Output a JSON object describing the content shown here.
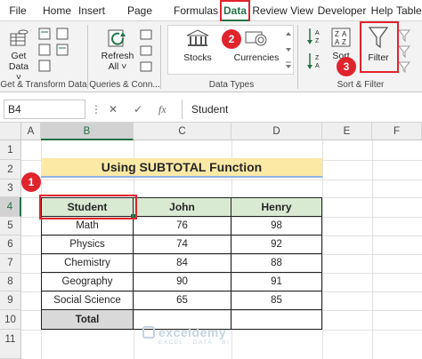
{
  "ribbon_tabs": [
    "File",
    "Home",
    "Insert",
    "Page Layout",
    "Formulas",
    "Data",
    "Review",
    "View",
    "Developer",
    "Help",
    "Table"
  ],
  "active_tab": "Data",
  "buttons": {
    "get_data": [
      "Get",
      "Data ˅"
    ],
    "refresh_all": [
      "Refresh",
      "All ˅"
    ],
    "stocks": "Stocks",
    "currencies": "Currencies",
    "sort": "Sort",
    "filter": "Filter"
  },
  "groups": {
    "get_transform": "Get & Transform Data",
    "queries": "Queries & Conn...",
    "data_types": "Data Types",
    "sort_filter": "Sort & Filter"
  },
  "markers": [
    "1",
    "2",
    "3"
  ],
  "formula_bar": {
    "name_box": "B4",
    "cancel": "✕",
    "enter": "✓",
    "fx": "fx",
    "content": "Student"
  },
  "columns": [
    "A",
    "B",
    "C",
    "D",
    "E",
    "F"
  ],
  "rows": [
    "1",
    "2",
    "3",
    "4",
    "5",
    "6",
    "7",
    "8",
    "9",
    "10",
    "11"
  ],
  "sheet": {
    "title": "Using SUBTOTAL Function",
    "headers": [
      "Student",
      "John",
      "Henry"
    ],
    "data": [
      [
        "Math",
        "76",
        "98"
      ],
      [
        "Physics",
        "74",
        "92"
      ],
      [
        "Chemistry",
        "84",
        "88"
      ],
      [
        "Geography",
        "90",
        "91"
      ],
      [
        "Social Science",
        "65",
        "85"
      ]
    ],
    "total_label": "Total"
  },
  "watermark": {
    "name": "exceldemy",
    "tagline": "EXCEL · DATA · BI"
  },
  "colors": {
    "accent_green": "#217346",
    "highlight_red": "#e0242c",
    "title_fill": "#fce9a6",
    "header_fill": "#d9ead3",
    "total_fill": "#d9d9d9"
  }
}
